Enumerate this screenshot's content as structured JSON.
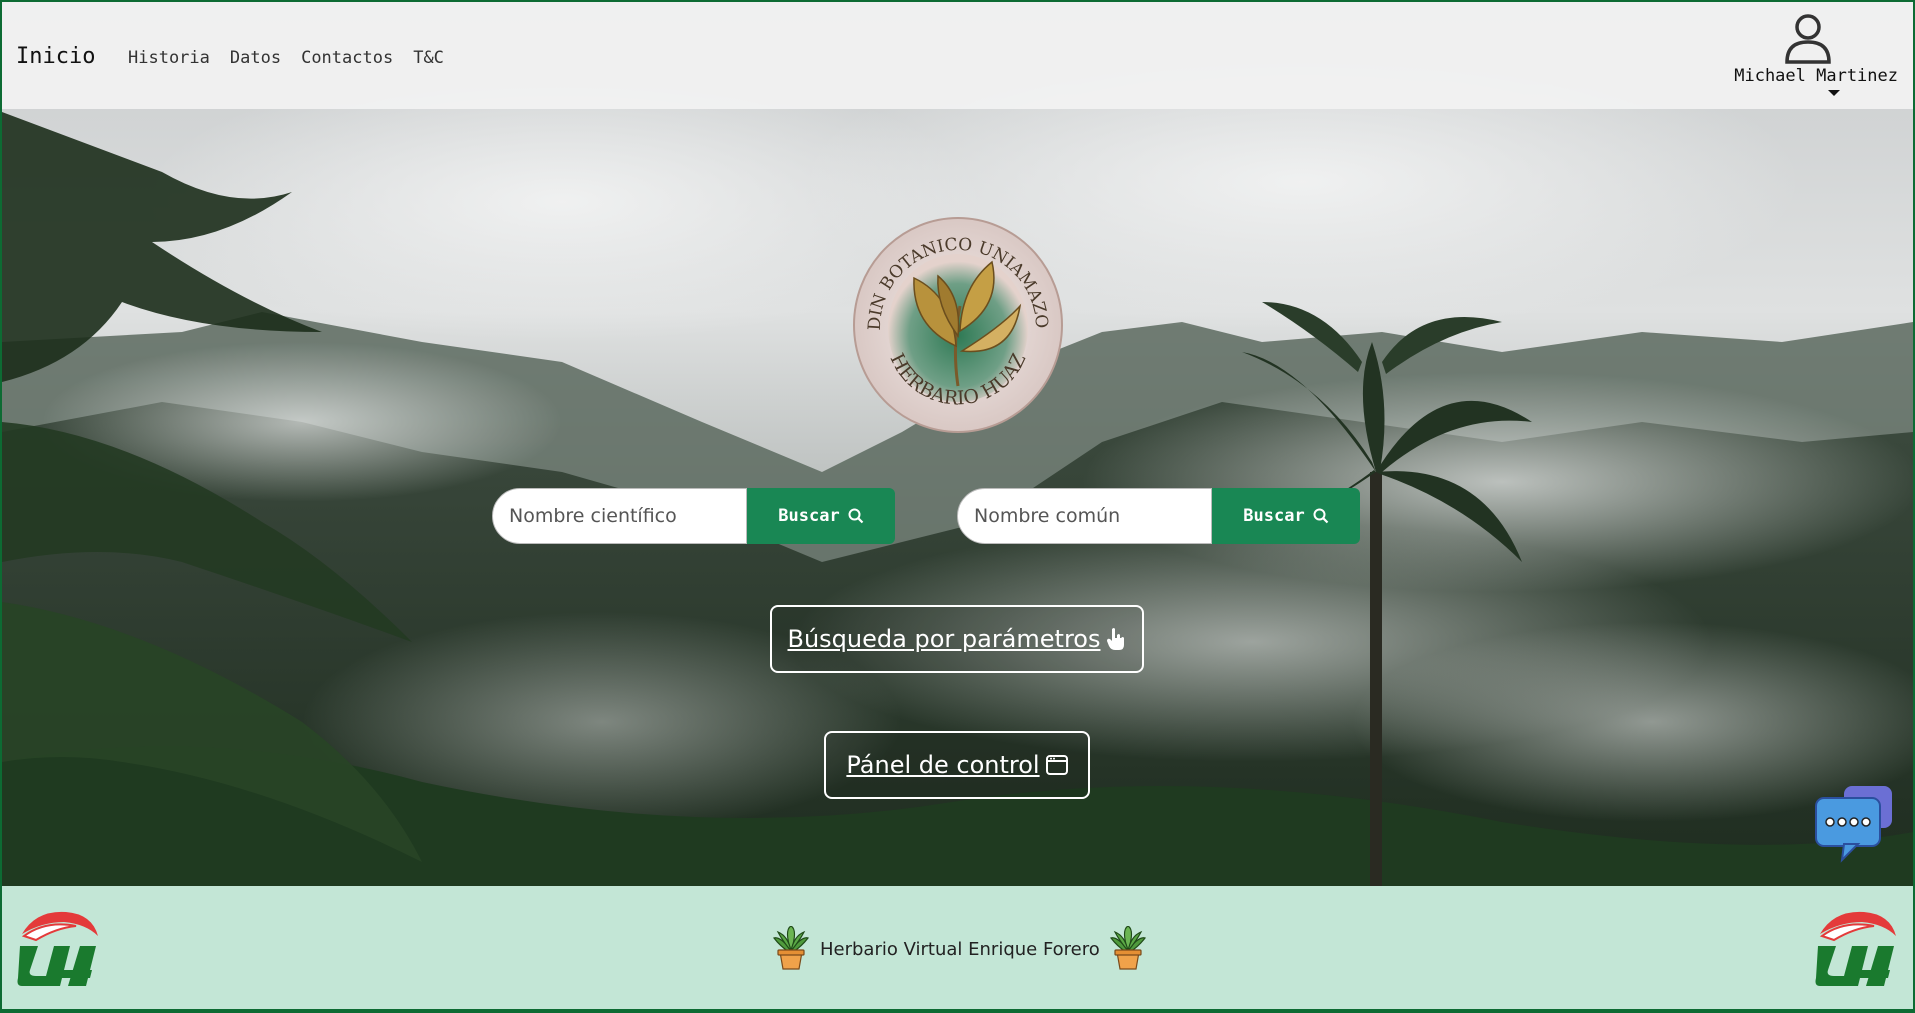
{
  "navbar": {
    "brand": "Inicio",
    "links": [
      "Historia",
      "Datos",
      "Contactos",
      "T&C"
    ],
    "user_name": "Michael Martinez"
  },
  "logo": {
    "top_text": "JARDIN BOTANICO UNIAMAZONIA",
    "bottom_text": "HERBARIO HUAZ"
  },
  "search": {
    "scientific_placeholder": "Nombre científico",
    "common_placeholder": "Nombre común",
    "button_label": "Buscar"
  },
  "actions": {
    "parametric_search": "Búsqueda por parámetros",
    "control_panel": "Pánel de control"
  },
  "footer": {
    "title": "Herbario Virtual Enrique Forero"
  },
  "colors": {
    "primary_green": "#198754",
    "footer_bg": "#c3e6d6",
    "frame_border": "#0d6b33"
  },
  "icons": [
    "user-icon",
    "caret-down-icon",
    "search-icon",
    "pointer-hand-icon",
    "window-icon",
    "chat-icon",
    "plant-icon",
    "ua-logo"
  ]
}
